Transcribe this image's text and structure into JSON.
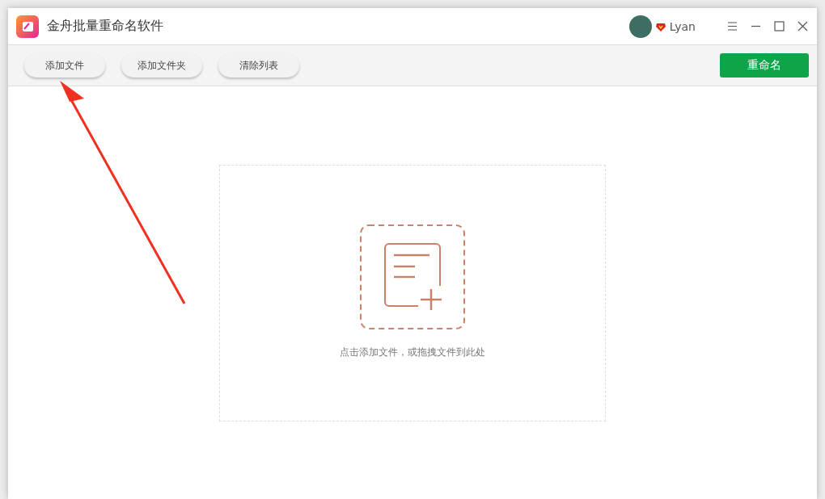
{
  "window": {
    "title": "金舟批量重命名软件"
  },
  "user": {
    "name": "Lyan"
  },
  "toolbar": {
    "buttons": [
      "添加文件",
      "添加文件夹",
      "清除列表"
    ],
    "primary_button": "重命名"
  },
  "drop_zone": {
    "hint": "点击添加文件，或拖拽文件到此处"
  }
}
